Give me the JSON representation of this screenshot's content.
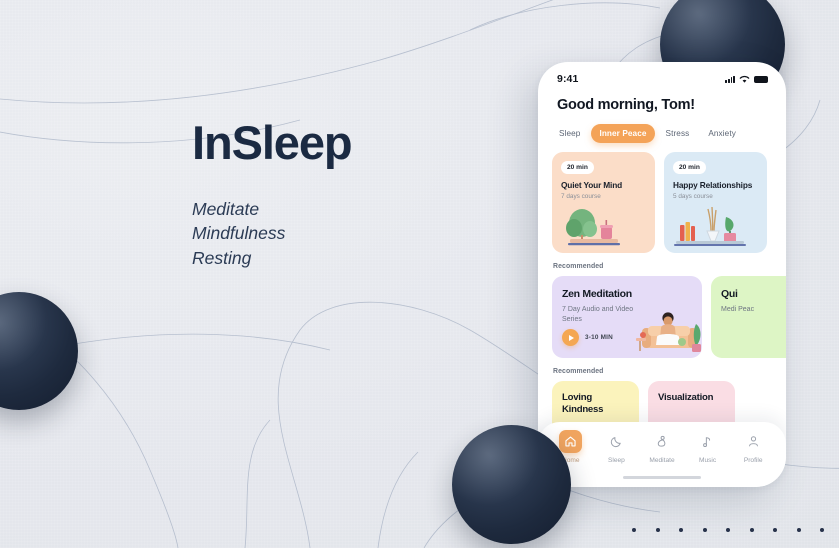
{
  "hero": {
    "title": "InSleep",
    "subtitle_lines": [
      "Meditate",
      "Mindfulness",
      "Resting"
    ]
  },
  "colors": {
    "background": "#e6e8ee",
    "sphere": "#1e2a3e",
    "accent": "#f4a358",
    "text_dark": "#1b2a42",
    "card_peach": "#fbddc8",
    "card_blue": "#dbeaf5",
    "card_purple": "#e5dcf7",
    "card_green": "#ddf5c5",
    "card_yellow": "#fbf3bc",
    "card_pink": "#fadde4"
  },
  "phone": {
    "status": {
      "time": "9:41",
      "signal_icon": "signal-bars-icon",
      "wifi_icon": "wifi-icon",
      "battery_icon": "battery-icon"
    },
    "greeting": "Good morning, Tom!",
    "chips": [
      {
        "label": "Sleep",
        "active": false
      },
      {
        "label": "Inner Peace",
        "active": true
      },
      {
        "label": "Stress",
        "active": false
      },
      {
        "label": "Anxiety",
        "active": false
      }
    ],
    "courses": [
      {
        "duration": "20 min",
        "title": "Quiet Your Mind",
        "subtitle": "7 days course",
        "color": "#fbddc8"
      },
      {
        "duration": "20 min",
        "title": "Happy Relationships",
        "subtitle": "5 days course",
        "color": "#dbeaf5"
      }
    ],
    "recommended_label_1": "Recommended",
    "recommended": [
      {
        "title": "Zen Meditation",
        "subtitle": "7 Day Audio and Video Series",
        "play_label": "3-10 MIN",
        "color": "#e5dcf7"
      },
      {
        "title": "Qui",
        "subtitle": "Medi Peac",
        "color": "#ddf5c5"
      }
    ],
    "recommended_label_2": "Recommended",
    "mini_cards": [
      {
        "title": "Loving Kindness",
        "color": "#fbf3bc"
      },
      {
        "title": "Visualization",
        "color": "#fadde4"
      }
    ],
    "tabs": [
      {
        "label": "Home",
        "icon": "home-icon",
        "active": true
      },
      {
        "label": "Sleep",
        "icon": "moon-icon",
        "active": false
      },
      {
        "label": "Meditate",
        "icon": "meditate-icon",
        "active": false
      },
      {
        "label": "Music",
        "icon": "music-note-icon",
        "active": false
      },
      {
        "label": "Profile",
        "icon": "person-icon",
        "active": false
      }
    ]
  },
  "pagination": {
    "dot_count": 10
  }
}
